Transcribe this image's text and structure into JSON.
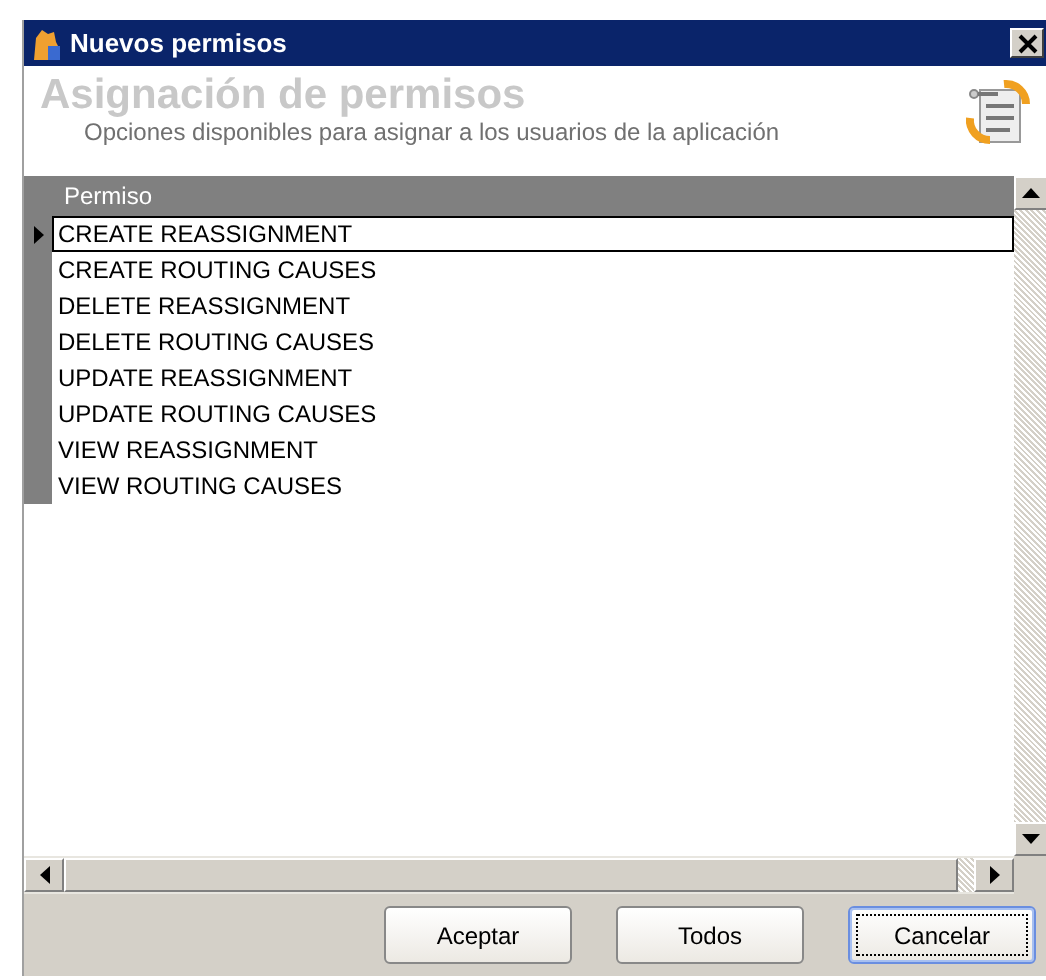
{
  "window": {
    "title": "Nuevos permisos"
  },
  "header": {
    "title": "Asignación de permisos",
    "subtitle": "Opciones disponibles para asignar a los usuarios de la aplicación"
  },
  "table": {
    "columns": [
      "Permiso"
    ],
    "rows": [
      {
        "permiso": "CREATE REASSIGNMENT",
        "selected": true
      },
      {
        "permiso": "CREATE ROUTING CAUSES",
        "selected": false
      },
      {
        "permiso": "DELETE REASSIGNMENT",
        "selected": false
      },
      {
        "permiso": "DELETE ROUTING CAUSES",
        "selected": false
      },
      {
        "permiso": "UPDATE REASSIGNMENT",
        "selected": false
      },
      {
        "permiso": "UPDATE ROUTING CAUSES",
        "selected": false
      },
      {
        "permiso": "VIEW REASSIGNMENT",
        "selected": false
      },
      {
        "permiso": "VIEW ROUTING CAUSES",
        "selected": false
      }
    ]
  },
  "buttons": [
    {
      "label": "Aceptar",
      "focused": false
    },
    {
      "label": "Todos",
      "focused": false
    },
    {
      "label": "Cancelar",
      "focused": true
    }
  ]
}
